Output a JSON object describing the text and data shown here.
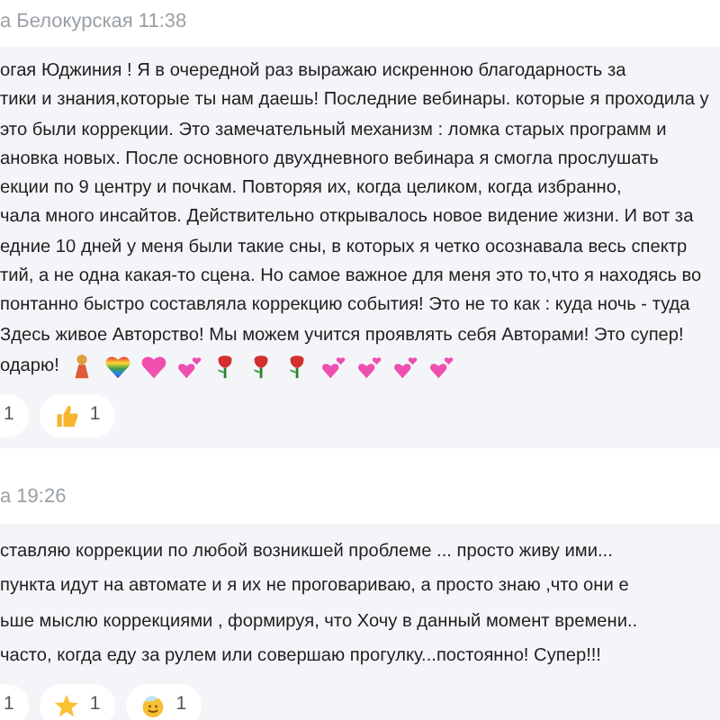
{
  "messages": [
    {
      "header": "а Белокурская 11:38",
      "lines": [
        "огая Юджиния ! Я в очередной раз выражаю искренною благодарность за",
        "тики и знания,которые ты нам даешь! Последние вебинары. которые я проходила у",
        "это были коррекции. Это замечательный механизм : ломка старых программ и",
        "ановка новых. После основного двухдневного вебинара я смогла прослушать",
        "екции по 9 центру и почкам. Повторяя их, когда целиком, когда избранно,",
        "чала много инсайтов. Действительно открывалось новое видение жизни. И вот за",
        "едние 10 дней у меня были такие сны, в которых я четко осознавала весь спектр",
        "тий, а не одна какая-то сцена. Но самое важное для меня это то,что я находясь во",
        "понтанно быстро составляла коррекцию события! Это не то как : куда ночь - туда",
        "Здесь живое Авторство! Мы можем учится проявлять себя Авторами! Это супер!"
      ],
      "last_line": "одарю!",
      "emojis": [
        {
          "kind": "woman"
        },
        {
          "kind": "rainbow-heart"
        },
        {
          "kind": "big-heart"
        },
        {
          "kind": "two-hearts"
        },
        {
          "kind": "rose"
        },
        {
          "kind": "rose"
        },
        {
          "kind": "rose"
        },
        {
          "kind": "two-hearts"
        },
        {
          "kind": "two-hearts"
        },
        {
          "kind": "two-hearts"
        },
        {
          "kind": "two-hearts"
        }
      ],
      "reactions": [
        {
          "kind": "cut",
          "count": "1"
        },
        {
          "kind": "thumbs-up",
          "count": "1"
        }
      ]
    },
    {
      "header": "а 19:26",
      "lines": [
        "ставляю коррекции по любой возникшей  проблеме ... просто живу ими...",
        "пункта  идут на автомате и я их не проговариваю, а просто знаю ,что они е",
        "ьше мыслю коррекциями , формируя, что Хочу в данный момент времени..",
        "часто, когда еду за рулем или совершаю прогулку...постоянно! Супер!!!"
      ],
      "reactions": [
        {
          "kind": "cut",
          "count": "1"
        },
        {
          "kind": "star",
          "count": "1"
        },
        {
          "kind": "smiley",
          "count": "1"
        }
      ]
    }
  ]
}
